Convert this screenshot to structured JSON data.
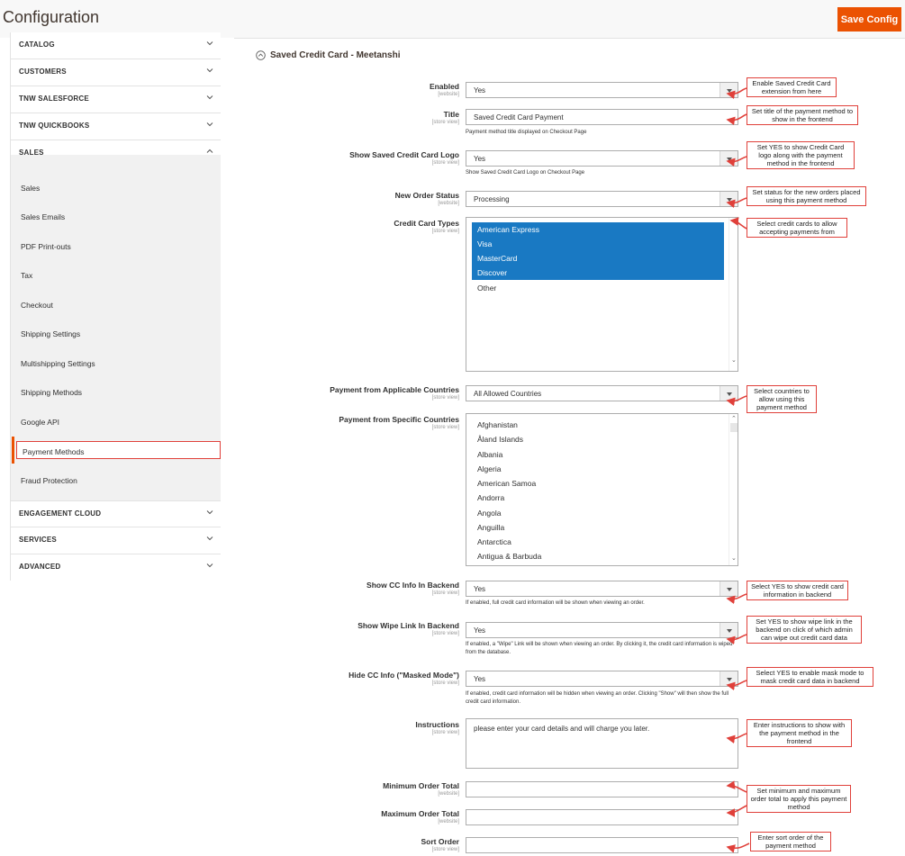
{
  "header": {
    "title": "Configuration",
    "save_label": "Save Config"
  },
  "sidebar": {
    "sections": [
      {
        "label": "CATALOG",
        "state": "collapsed"
      },
      {
        "label": "CUSTOMERS",
        "state": "collapsed"
      },
      {
        "label": "TNW SALESFORCE",
        "state": "collapsed"
      },
      {
        "label": "TNW QUICKBOOKS",
        "state": "collapsed"
      },
      {
        "label": "SALES",
        "state": "expanded"
      },
      {
        "label": "ENGAGEMENT CLOUD",
        "state": "collapsed"
      },
      {
        "label": "SERVICES",
        "state": "collapsed"
      },
      {
        "label": "ADVANCED",
        "state": "collapsed"
      }
    ],
    "sales_items": [
      "Sales",
      "Sales Emails",
      "PDF Print-outs",
      "Tax",
      "Checkout",
      "Shipping Settings",
      "Multishipping Settings",
      "Shipping Methods",
      "Google API",
      "Payment Methods",
      "Fraud Protection"
    ],
    "active_item": "Payment Methods"
  },
  "section": {
    "title": "Saved Credit Card - Meetanshi"
  },
  "fields": {
    "enabled": {
      "label": "Enabled",
      "scope": "[website]",
      "value": "Yes"
    },
    "title": {
      "label": "Title",
      "scope": "[store view]",
      "value": "Saved Credit Card Payment",
      "note": "Payment method title displayed on Checkout Page"
    },
    "show_logo": {
      "label": "Show Saved Credit Card Logo",
      "scope": "[store view]",
      "value": "Yes",
      "note": "Show Saved Credit Card Logo on Checkout Page"
    },
    "order_status": {
      "label": "New Order Status",
      "scope": "[website]",
      "value": "Processing"
    },
    "cc_types": {
      "label": "Credit Card Types",
      "scope": "[store view]",
      "options": [
        {
          "text": "American Express",
          "selected": true
        },
        {
          "text": "Visa",
          "selected": true
        },
        {
          "text": "MasterCard",
          "selected": true
        },
        {
          "text": "Discover",
          "selected": true
        },
        {
          "text": "Other",
          "selected": false
        }
      ]
    },
    "applicable_countries": {
      "label": "Payment from Applicable Countries",
      "scope": "[store view]",
      "value": "All Allowed Countries"
    },
    "specific_countries": {
      "label": "Payment from Specific Countries",
      "scope": "[store view]",
      "options": [
        "Afghanistan",
        "Åland Islands",
        "Albania",
        "Algeria",
        "American Samoa",
        "Andorra",
        "Angola",
        "Anguilla",
        "Antarctica",
        "Antigua & Barbuda"
      ]
    },
    "show_cc_backend": {
      "label": "Show CC Info In Backend",
      "scope": "[store view]",
      "value": "Yes",
      "note": "If enabled, full credit card information will be shown when viewing an order."
    },
    "show_wipe": {
      "label": "Show Wipe Link In Backend",
      "scope": "[store view]",
      "value": "Yes",
      "note": "If enabled, a \"Wipe\" Link will be shown when viewing an order. By clicking it, the credit card information is wiped from the database."
    },
    "hide_cc": {
      "label": "Hide CC Info (\"Masked Mode\")",
      "scope": "[store view]",
      "value": "Yes",
      "note": "If enabled, credit card information will be hidden when viewing an order. Clicking \"Show\" will then show the full credit card information."
    },
    "instructions": {
      "label": "Instructions",
      "scope": "[store view]",
      "value": "please enter your card details and will charge you later."
    },
    "min_total": {
      "label": "Minimum Order Total",
      "scope": "[website]",
      "value": ""
    },
    "max_total": {
      "label": "Maximum Order Total",
      "scope": "[website]",
      "value": ""
    },
    "sort_order": {
      "label": "Sort Order",
      "scope": "[store view]",
      "value": ""
    }
  },
  "callouts": {
    "enabled": "Enable Saved Credit Card extension from here",
    "title": "Set title of the payment method to show in the frontend",
    "logo": "Set YES to show Credit Card logo along with the payment method in the frontend",
    "status": "Set status for the new orders placed using this payment method",
    "cc_types": "Select credit cards to allow accepting payments from",
    "countries": "Select countries to allow using this payment method",
    "cc_backend": "Select YES to show credit card information in backend",
    "wipe": "Set YES to show wipe link in the backend on click of which admin can wipe out credit card data",
    "mask": "Select YES to enable mask mode to mask credit card data in backend",
    "instructions": "Enter instructions to show with the payment method in the frontend",
    "totals": "Set minimum and maximum order total to apply this payment method",
    "sort": "Enter sort order of the payment method"
  },
  "colors": {
    "accent": "#eb5202",
    "selection": "#1979c3",
    "callout_border": "#e0403a"
  }
}
